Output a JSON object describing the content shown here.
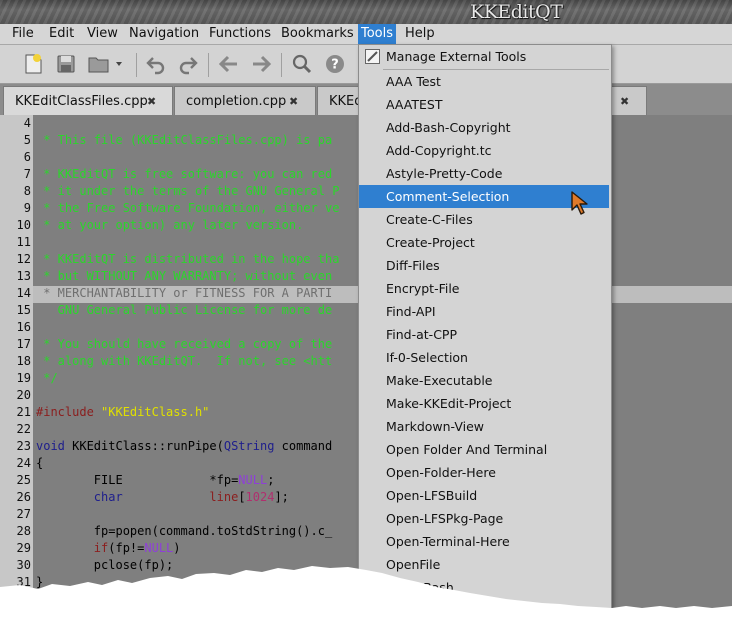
{
  "window": {
    "title": "KKEditQT"
  },
  "menubar": [
    "File",
    "Edit",
    "View",
    "Navigation",
    "Functions",
    "Bookmarks",
    "Tools",
    "Help"
  ],
  "active_menu": "Tools",
  "toolbar": {
    "icons": [
      "new-file-icon",
      "save-icon",
      "open-folder-icon",
      "dropdown-arrow-icon",
      "undo-icon",
      "redo-icon",
      "back-icon",
      "forward-icon",
      "find-icon",
      "help-icon"
    ]
  },
  "tabs": [
    {
      "label": "KKEditClassFiles.cpp",
      "active": true
    },
    {
      "label": "completion.cpp",
      "active": false
    },
    {
      "label": "KKEd",
      "active": false
    }
  ],
  "editor": {
    "lines": [
      {
        "num": "4",
        "text": ""
      },
      {
        "num": "5",
        "text": " * This file (KKEditClassFiles.cpp) is pa"
      },
      {
        "num": "6",
        "text": ""
      },
      {
        "num": "7",
        "text": " * KKEditQT is free software: you can red"
      },
      {
        "num": "8",
        "text": " * it under the terms of the GNU General P"
      },
      {
        "num": "9",
        "text": " * the Free Software Foundation, either ve"
      },
      {
        "num": "10",
        "text": " * at your option) any later version."
      },
      {
        "num": "11",
        "text": ""
      },
      {
        "num": "12",
        "text": " * KKEditQT is distributed in the hope tha"
      },
      {
        "num": "13",
        "text": " * but WITHOUT ANY WARRANTY; without even "
      },
      {
        "num": "14",
        "text": " * MERCHANTABILITY or FITNESS FOR A PARTI"
      },
      {
        "num": "15",
        "text": "   GNU General Public License for more de"
      },
      {
        "num": "16",
        "text": ""
      },
      {
        "num": "17",
        "text": " * You should have received a copy of the"
      },
      {
        "num": "18",
        "text": " * along with KKEditQT.  If not, see <htt"
      },
      {
        "num": "19",
        "text": " */"
      },
      {
        "num": "20",
        "text": ""
      },
      {
        "num": "21",
        "text": "#include \"KKEditClass.h\""
      },
      {
        "num": "22",
        "text": ""
      },
      {
        "num": "23",
        "text": "void KKEditClass::runPipe(QString command"
      },
      {
        "num": "24",
        "text": "{"
      },
      {
        "num": "25",
        "text": "        FILE            *fp=NULL;"
      },
      {
        "num": "26",
        "text": "        char            line[1024];"
      },
      {
        "num": "27",
        "text": ""
      },
      {
        "num": "28",
        "text": "        fp=popen(command.toStdString().c_"
      },
      {
        "num": "29",
        "text": "        if(fp!=NULL)"
      },
      {
        "num": "30",
        "text": "                pclose(fp);"
      },
      {
        "num": "31",
        "text": "}"
      }
    ],
    "tokens": {
      "include": "#include",
      "header": "\"KKEditClass.h\"",
      "void": "void",
      "run_pipe_a": " KKEditClass::runPipe(",
      "qstring": "QString",
      "run_pipe_b": " command",
      "brace_open": "{",
      "file_decl_a": "        FILE            *fp=",
      "null": "NULL",
      "semi": ";",
      "char": "char",
      "line_decl_a": "            ",
      "line_kw": "line",
      "bracket_open": "[",
      "size": "1024",
      "bracket_close": "];",
      "popen": "        fp=popen(command.toStdString().c_",
      "if": "if",
      "if_b": "(fp!=",
      "if_c": ")",
      "pclose": "        pclose(fp);",
      "brace_close": "}"
    }
  },
  "tools_menu": {
    "header": "Manage External Tools",
    "items": [
      "AAA Test",
      "AAATEST",
      "Add-Bash-Copyright",
      "Add-Copyright.tc",
      "Astyle-Pretty-Code",
      "Comment-Selection",
      "Create-C-Files",
      "Create-Project",
      "Diff-Files",
      "Encrypt-File",
      "Find-API",
      "Find-at-CPP",
      "If-0-Selection",
      "Make-Executable",
      "Make-KKEdit-Project",
      "Markdown-View",
      "Open Folder And Terminal",
      "Open-Folder-Here",
      "Open-LFSBuild",
      "Open-LFSPkg-Page",
      "Open-Terminal-Here",
      "OpenFile",
      "PrettyBash"
    ],
    "selected": "Comment-Selection"
  },
  "colors": {
    "selection": "#2f7fd0",
    "comment": "#2bd62b",
    "string": "#e0e000",
    "null_constant": "#8f3fd8"
  }
}
